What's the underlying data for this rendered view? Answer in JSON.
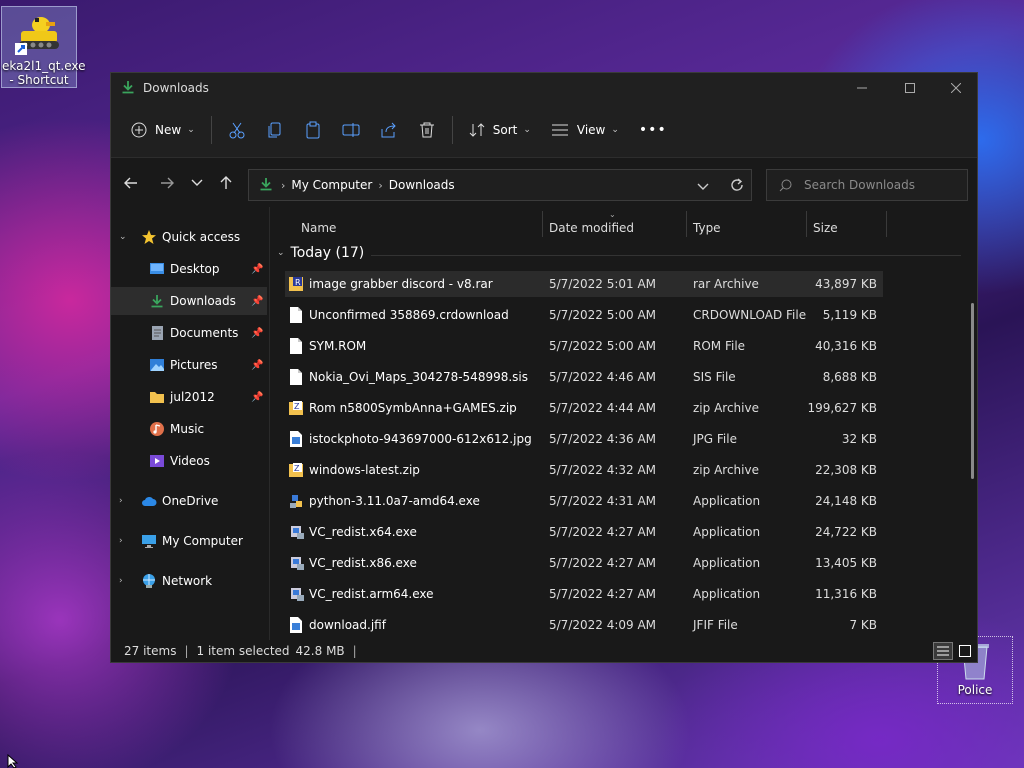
{
  "desktop": {
    "icons": [
      {
        "label_line1": "eka2l1_qt.exe",
        "label_line2": "- Shortcut"
      },
      {
        "label": "Police"
      }
    ]
  },
  "window": {
    "title": "Downloads",
    "toolbar": {
      "new_label": "New",
      "sort_label": "Sort",
      "view_label": "View",
      "more_glyph": "•••"
    },
    "address": {
      "crumbs": [
        "My Computer",
        "Downloads"
      ]
    },
    "search": {
      "placeholder": "Search Downloads"
    },
    "sidebar": {
      "quick_access": "Quick access",
      "items": [
        "Desktop",
        "Downloads",
        "Documents",
        "Pictures",
        "jul2012",
        "Music",
        "Videos"
      ],
      "onedrive": "OneDrive",
      "my_computer": "My Computer",
      "network": "Network"
    },
    "columns": {
      "name": "Name",
      "date": "Date modified",
      "type": "Type",
      "size": "Size"
    },
    "group": {
      "label": "Today (17)"
    },
    "files": [
      {
        "name": "image grabber discord - v8.rar",
        "date": "5/7/2022 5:01 AM",
        "type": "rar Archive",
        "size": "43,897 KB",
        "icon": "rar-icon"
      },
      {
        "name": "Unconfirmed 358869.crdownload",
        "date": "5/7/2022 5:00 AM",
        "type": "CRDOWNLOAD File",
        "size": "5,119 KB",
        "icon": "file-icon"
      },
      {
        "name": "SYM.ROM",
        "date": "5/7/2022 5:00 AM",
        "type": "ROM File",
        "size": "40,316 KB",
        "icon": "file-icon"
      },
      {
        "name": "Nokia_Ovi_Maps_304278-548998.sis",
        "date": "5/7/2022 4:46 AM",
        "type": "SIS File",
        "size": "8,688 KB",
        "icon": "file-icon"
      },
      {
        "name": "Rom n5800SymbAnna+GAMES.zip",
        "date": "5/7/2022 4:44 AM",
        "type": "zip Archive",
        "size": "199,627 KB",
        "icon": "zip-icon"
      },
      {
        "name": "istockphoto-943697000-612x612.jpg",
        "date": "5/7/2022 4:36 AM",
        "type": "JPG File",
        "size": "32 KB",
        "icon": "image-file-icon"
      },
      {
        "name": "windows-latest.zip",
        "date": "5/7/2022 4:32 AM",
        "type": "zip Archive",
        "size": "22,308 KB",
        "icon": "zip-icon"
      },
      {
        "name": "python-3.11.0a7-amd64.exe",
        "date": "5/7/2022 4:31 AM",
        "type": "Application",
        "size": "24,148 KB",
        "icon": "python-icon"
      },
      {
        "name": "VC_redist.x64.exe",
        "date": "5/7/2022 4:27 AM",
        "type": "Application",
        "size": "24,722 KB",
        "icon": "installer-icon"
      },
      {
        "name": "VC_redist.x86.exe",
        "date": "5/7/2022 4:27 AM",
        "type": "Application",
        "size": "13,405 KB",
        "icon": "installer-icon"
      },
      {
        "name": "VC_redist.arm64.exe",
        "date": "5/7/2022 4:27 AM",
        "type": "Application",
        "size": "11,316 KB",
        "icon": "installer-icon"
      },
      {
        "name": "download.jfif",
        "date": "5/7/2022 4:09 AM",
        "type": "JFIF File",
        "size": "7 KB",
        "icon": "image-file-icon"
      }
    ],
    "status": {
      "items_count": "27 items",
      "selected": "1 item selected",
      "selected_size": "42.8 MB",
      "divider": "|"
    }
  },
  "colors": {
    "accent": "#3aa55d",
    "window_bg": "#191919",
    "selection": "#2b2b2b"
  }
}
